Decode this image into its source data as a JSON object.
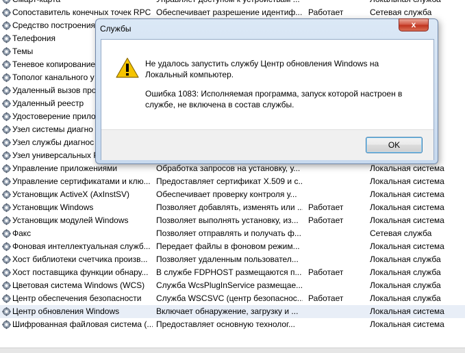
{
  "services": [
    {
      "name": "Смарт-карта",
      "desc": "Управляет доступом к устройствам ...",
      "status": "",
      "startup": "Локальная служба"
    },
    {
      "name": "Сопоставитель конечных точек RPC",
      "desc": "Обеспечивает разрешение идентиф...",
      "status": "Работает",
      "startup": "Сетевая служба"
    },
    {
      "name": "Средство построения",
      "desc": "",
      "status": "",
      "startup": ""
    },
    {
      "name": "Телефония",
      "desc": "",
      "status": "",
      "startup": ""
    },
    {
      "name": "Темы",
      "desc": "",
      "status": "",
      "startup": ""
    },
    {
      "name": "Теневое копирование",
      "desc": "",
      "status": "",
      "startup": ""
    },
    {
      "name": "Тополог канального у",
      "desc": "",
      "status": "",
      "startup": ""
    },
    {
      "name": "Удаленный вызов про",
      "desc": "",
      "status": "",
      "startup": ""
    },
    {
      "name": "Удаленный реестр",
      "desc": "",
      "status": "",
      "startup": ""
    },
    {
      "name": "Удостоверение прило",
      "desc": "",
      "status": "",
      "startup": ""
    },
    {
      "name": "Узел системы диагно",
      "desc": "",
      "status": "",
      "startup": ""
    },
    {
      "name": "Узел службы диагнос",
      "desc": "",
      "status": "",
      "startup": ""
    },
    {
      "name": "Узел универсальных P",
      "desc": "",
      "status": "",
      "startup": ""
    },
    {
      "name": "Управление приложениями",
      "desc": "Обработка запросов на установку, у...",
      "status": "",
      "startup": "Локальная система"
    },
    {
      "name": "Управление сертификатами и клю...",
      "desc": "Предоставляет сертификат X.509 и с...",
      "status": "",
      "startup": "Локальная система"
    },
    {
      "name": "Установщик ActiveX (AxInstSV)",
      "desc": "Обеспечивает проверку контроля у...",
      "status": "",
      "startup": "Локальная система"
    },
    {
      "name": "Установщик Windows",
      "desc": "Позволяет добавлять, изменять или ...",
      "status": "Работает",
      "startup": "Локальная система"
    },
    {
      "name": "Установщик модулей Windows",
      "desc": "Позволяет выполнять установку, из...",
      "status": "Работает",
      "startup": "Локальная система"
    },
    {
      "name": "Факс",
      "desc": "Позволяет отправлять и получать ф...",
      "status": "",
      "startup": "Сетевая служба"
    },
    {
      "name": "Фоновая интеллектуальная служб...",
      "desc": "Передает файлы в фоновом режим...",
      "status": "",
      "startup": "Локальная система"
    },
    {
      "name": "Хост библиотеки счетчика произв...",
      "desc": "Позволяет удаленным пользовател...",
      "status": "",
      "startup": "Локальная служба"
    },
    {
      "name": "Хост поставщика функции обнару...",
      "desc": "В службе FDPHOST размещаются п...",
      "status": "Работает",
      "startup": "Локальная служба"
    },
    {
      "name": "Цветовая система Windows (WCS)",
      "desc": "Служба WcsPlugInService размещае...",
      "status": "",
      "startup": "Локальная служба"
    },
    {
      "name": "Центр обеспечения безопасности",
      "desc": "Служба WSCSVC (центр безопаснос...",
      "status": "Работает",
      "startup": "Локальная служба"
    },
    {
      "name": "Центр обновления Windows",
      "desc": "Включает обнаружение, загрузку и ...",
      "status": "",
      "startup": "Локальная система",
      "selected": true
    },
    {
      "name": "Шифрованная файловая система (...",
      "desc": "Предоставляет основную технолог...",
      "status": "",
      "startup": "Локальная система"
    }
  ],
  "dialog": {
    "title": "Службы",
    "close_label": "x",
    "message_line1": "Не удалось запустить службу Центр обновления Windows на Локальный компьютер.",
    "message_line2": "Ошибка 1083: Исполняемая программа, запуск которой настроен в службе, не включена в состав службы.",
    "ok_label": "OK"
  },
  "icons": {
    "service": "gear-icon",
    "warning": "warning-icon"
  },
  "colors": {
    "selected_row": "#e8eef7",
    "close_button": "#c7402b",
    "warning": "#f5c400"
  }
}
